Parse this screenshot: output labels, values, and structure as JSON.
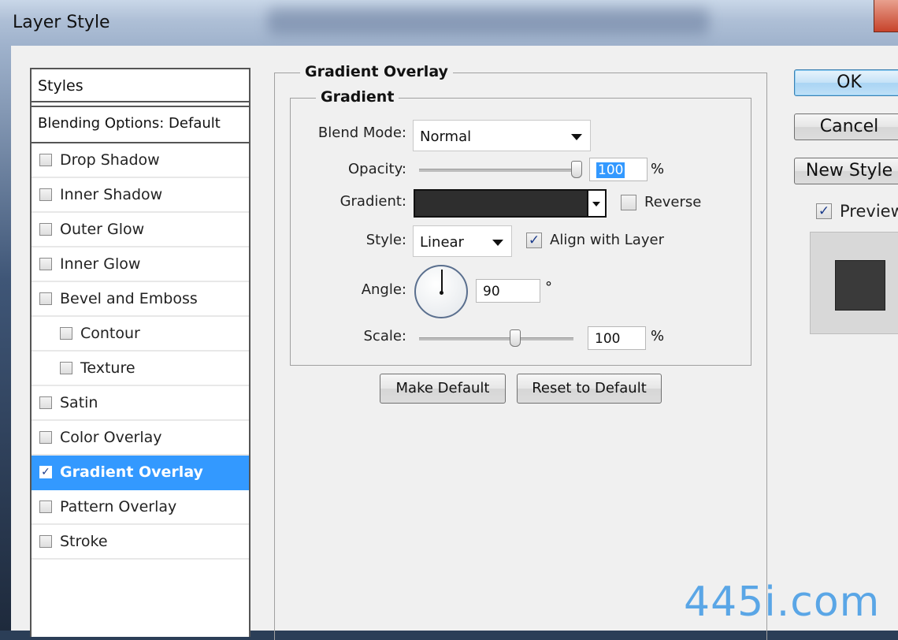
{
  "window": {
    "title": "Layer Style"
  },
  "styles_panel": {
    "header": "Styles",
    "blending_options": "Blending Options: Default",
    "items": [
      {
        "label": "Drop Shadow",
        "checked": false,
        "sub": false,
        "active": false
      },
      {
        "label": "Inner Shadow",
        "checked": false,
        "sub": false,
        "active": false
      },
      {
        "label": "Outer Glow",
        "checked": false,
        "sub": false,
        "active": false
      },
      {
        "label": "Inner Glow",
        "checked": false,
        "sub": false,
        "active": false
      },
      {
        "label": "Bevel and Emboss",
        "checked": false,
        "sub": false,
        "active": false
      },
      {
        "label": "Contour",
        "checked": false,
        "sub": true,
        "active": false
      },
      {
        "label": "Texture",
        "checked": false,
        "sub": true,
        "active": false
      },
      {
        "label": "Satin",
        "checked": false,
        "sub": false,
        "active": false
      },
      {
        "label": "Color Overlay",
        "checked": false,
        "sub": false,
        "active": false
      },
      {
        "label": "Gradient Overlay",
        "checked": true,
        "sub": false,
        "active": true
      },
      {
        "label": "Pattern Overlay",
        "checked": false,
        "sub": false,
        "active": false
      },
      {
        "label": "Stroke",
        "checked": false,
        "sub": false,
        "active": false
      }
    ]
  },
  "gradient_overlay": {
    "section_title": "Gradient Overlay",
    "group_title": "Gradient",
    "blend_mode_label": "Blend Mode:",
    "blend_mode_value": "Normal",
    "opacity_label": "Opacity:",
    "opacity_value": "100",
    "opacity_percent": 100,
    "percent_sign": "%",
    "gradient_label": "Gradient:",
    "gradient_color": "#2e2e2e",
    "reverse_label": "Reverse",
    "reverse_checked": false,
    "style_label": "Style:",
    "style_value": "Linear",
    "align_label": "Align with Layer",
    "align_checked": true,
    "angle_label": "Angle:",
    "angle_value": "90",
    "degree_sign": "°",
    "scale_label": "Scale:",
    "scale_value": "100",
    "make_default": "Make Default",
    "reset_default": "Reset to Default"
  },
  "actions": {
    "ok": "OK",
    "cancel": "Cancel",
    "new_style": "New Style",
    "preview_label": "Preview",
    "preview_checked": true
  },
  "watermark": "445i.com",
  "colors": {
    "accent": "#3399ff",
    "dialog_bg": "#f0f0f0",
    "preview_swatch": "#3a3a3a"
  },
  "icons": {
    "dropdown": "chevron-down-icon",
    "checkbox": "checkbox-icon",
    "dial": "angle-dial-icon"
  }
}
